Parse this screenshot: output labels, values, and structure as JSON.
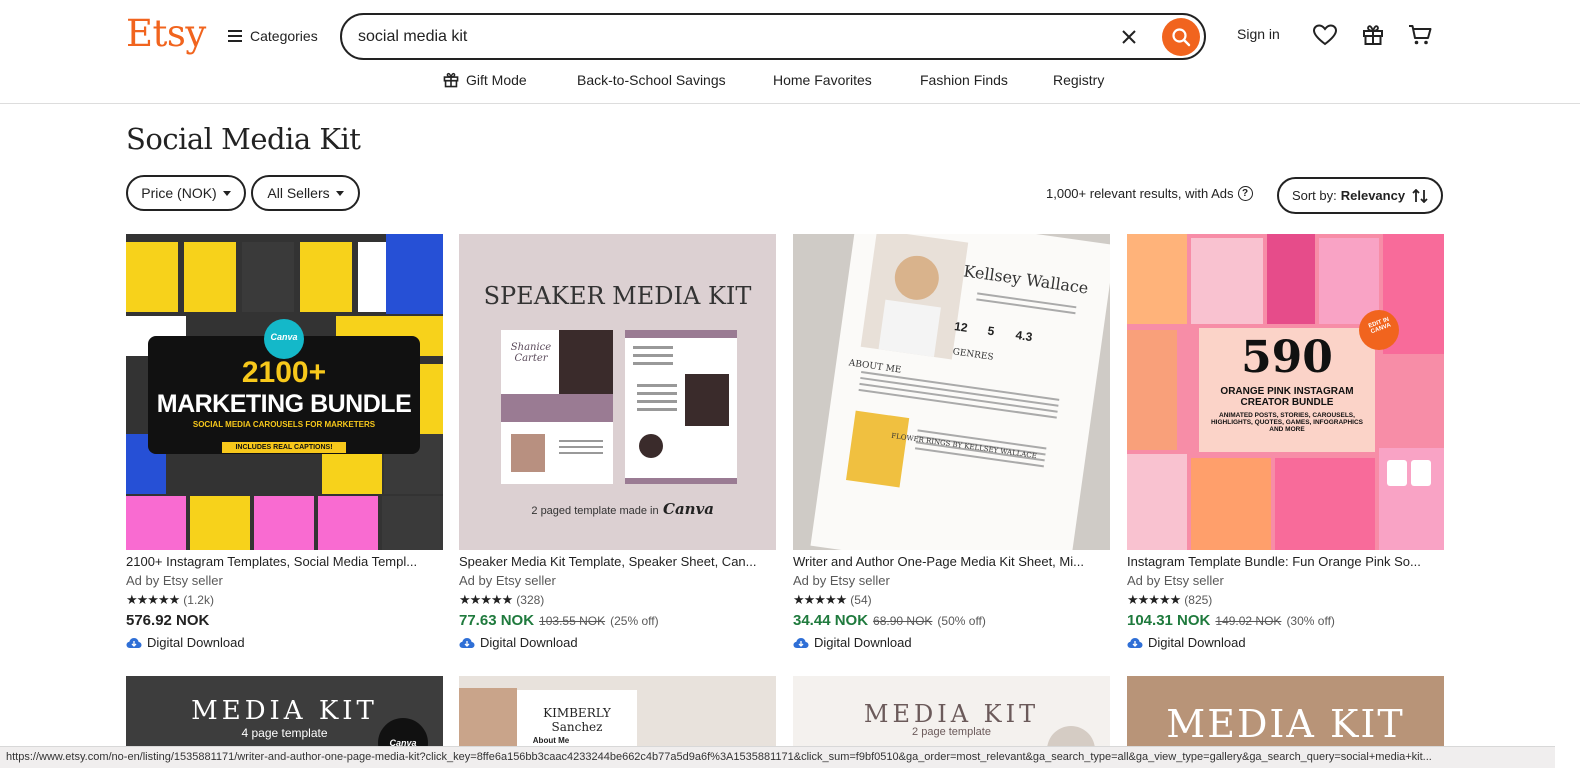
{
  "header": {
    "logo": "Etsy",
    "categories_label": "Categories",
    "search_value": "social media kit",
    "signin_label": "Sign in"
  },
  "nav": {
    "items": [
      "Gift Mode",
      "Back-to-School Savings",
      "Home Favorites",
      "Fashion Finds",
      "Registry"
    ]
  },
  "main": {
    "title": "Social Media Kit",
    "filters": [
      "Price (NOK)",
      "All Sellers"
    ],
    "results_text": "1,000+ relevant results, with Ads",
    "sort_prefix": "Sort by:",
    "sort_value": "Relevancy"
  },
  "listings": [
    {
      "title": "2100+ Instagram Templates, Social Media Templ...",
      "ad": "Ad by Etsy seller",
      "reviews": "(1.2k)",
      "price": "576.92 NOK",
      "original": "",
      "discount": "",
      "download": "Digital Download",
      "thumb": {
        "badge": "Canva",
        "headline": "2100+",
        "line2": "MARKETING BUNDLE",
        "line3": "SOCIAL MEDIA CAROUSELS FOR MARKETERS",
        "line4": "INCLUDES REAL CAPTIONS!"
      }
    },
    {
      "title": "Speaker Media Kit Template, Speaker Sheet, Can...",
      "ad": "Ad by Etsy seller",
      "reviews": "(328)",
      "price": "77.63 NOK",
      "original": "103.55 NOK",
      "discount": "(25% off)",
      "download": "Digital Download",
      "thumb": {
        "headline": "SPEAKER MEDIA KIT",
        "footer": "2 paged template made in",
        "brand": "Canva",
        "name": "Shanice Carter"
      }
    },
    {
      "title": "Writer and Author One-Page Media Kit Sheet, Mi...",
      "ad": "Ad by Etsy seller",
      "reviews": "(54)",
      "price": "34.44 NOK",
      "original": "68.90 NOK",
      "discount": "(50% off)",
      "download": "Digital Download",
      "thumb": {
        "name": "Kellsey Wallace",
        "stat1": "12",
        "stat2": "5",
        "stat3": "4.3",
        "genres": "GENRES",
        "about": "ABOUT ME",
        "section": "FLOWER RINGS BY KELLSEY WALLACE"
      }
    },
    {
      "title": "Instagram Template Bundle: Fun Orange Pink So...",
      "ad": "Ad by Etsy seller",
      "reviews": "(825)",
      "price": "104.31 NOK",
      "original": "149.02 NOK",
      "discount": "(30% off)",
      "download": "Digital Download",
      "thumb": {
        "headline": "590",
        "line2": "ORANGE PINK INSTAGRAM CREATOR BUNDLE",
        "line3": "ANIMATED POSTS, STORIES, CAROUSELS, HIGHLIGHTS, QUOTES, GAMES, INFOGRAPHICS AND MORE",
        "badge": "EDIT IN CANVA"
      }
    }
  ],
  "row2": [
    {
      "headline": "MEDIA KIT",
      "sub": "4 page template",
      "badge": "Canva"
    },
    {
      "headline": "KIMBERLY Sanchez",
      "sub": "About Me"
    },
    {
      "headline": "MEDIA KIT",
      "sub": "2 page template"
    },
    {
      "headline": "MEDIA KIT"
    }
  ],
  "status_url": "https://www.etsy.com/no-en/listing/1535881171/writer-and-author-one-page-media-kit?click_key=8ffe6a156bb3caac4233244be662c4b77a5d9a6f%3A1535881171&click_sum=f9bf0510&ga_order=most_relevant&ga_search_type=all&ga_view_type=gallery&ga_search_query=social+media+kit...",
  "colors": {
    "brand": "#f1641e",
    "sale": "#1f7a3d"
  }
}
